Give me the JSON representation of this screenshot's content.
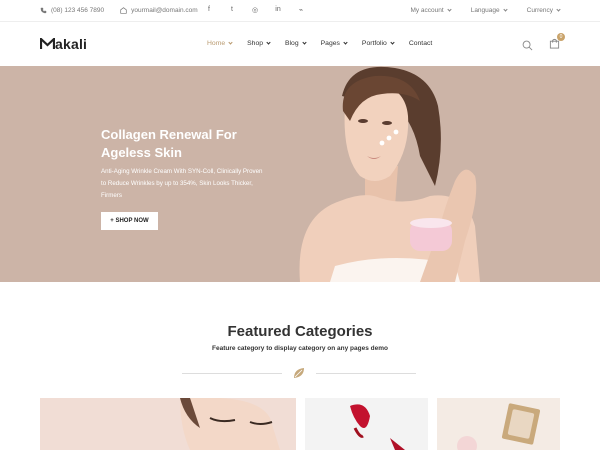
{
  "topbar": {
    "phone": "(08) 123 456 7890",
    "email": "yourmail@domain.com",
    "social_icons": [
      "facebook-icon",
      "twitter-icon",
      "instagram-icon",
      "linkedin-icon",
      "rss-icon"
    ],
    "social_glyphs": [
      "f",
      "t",
      "◎",
      "in",
      "⌁"
    ],
    "account": "My account",
    "language": "Language",
    "currency": "Currency"
  },
  "header": {
    "logo": "akali",
    "logo_mark": "M",
    "nav": [
      {
        "label": "Home"
      },
      {
        "label": "Shop"
      },
      {
        "label": "Blog"
      },
      {
        "label": "Pages"
      },
      {
        "label": "Portfolio"
      },
      {
        "label": "Contact"
      }
    ],
    "cart_count": "0"
  },
  "hero": {
    "title": "Collagen Renewal For Ageless Skin",
    "description": "Anti-Aging Wrinkle Cream With SYN-Coll, Clinically Proven to Reduce Wrinkles by up to 354%, Skin Looks Thicker, Firmers",
    "button": "+ SHOP NOW",
    "background": "#ccb4a7"
  },
  "featured": {
    "title": "Featured Categories",
    "subtitle": "Feature category to display category on any pages demo"
  },
  "colors": {
    "accent": "#b99a6f",
    "badge": "#c9a36a"
  }
}
